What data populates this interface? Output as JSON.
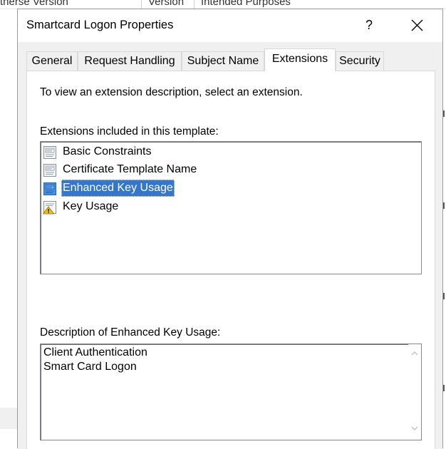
{
  "background_window": {
    "header_fragments": [
      "therse Version",
      "Version",
      "Intended Purposes"
    ]
  },
  "dialog": {
    "title": "Smartcard Logon Properties",
    "help_label": "?",
    "close_icon": "close-icon"
  },
  "tabs": [
    {
      "label": "General",
      "active": false
    },
    {
      "label": "Request Handling",
      "active": false
    },
    {
      "label": "Subject Name",
      "active": false
    },
    {
      "label": "Extensions",
      "active": true
    },
    {
      "label": "Security",
      "active": false
    }
  ],
  "extensions_tab": {
    "instruction": "To view an extension description, select an extension.",
    "list_label": "Extensions included in this template:",
    "extensions": [
      {
        "label": "Basic Constraints",
        "icon": "certificate-extension-icon",
        "selected": false
      },
      {
        "label": "Certificate Template Name",
        "icon": "certificate-extension-icon",
        "selected": false
      },
      {
        "label": "Enhanced Key Usage",
        "icon": "certificate-extension-icon",
        "selected": true
      },
      {
        "label": "Key Usage",
        "icon": "warning-extension-icon",
        "selected": false
      }
    ],
    "description_label": "Description of Enhanced Key Usage:",
    "description_lines": [
      "Client Authentication",
      "Smart Card Logon"
    ]
  },
  "colors": {
    "selection": "#3377cc",
    "dialog_body": "#f0f0f0",
    "warning": "#f5c400"
  }
}
